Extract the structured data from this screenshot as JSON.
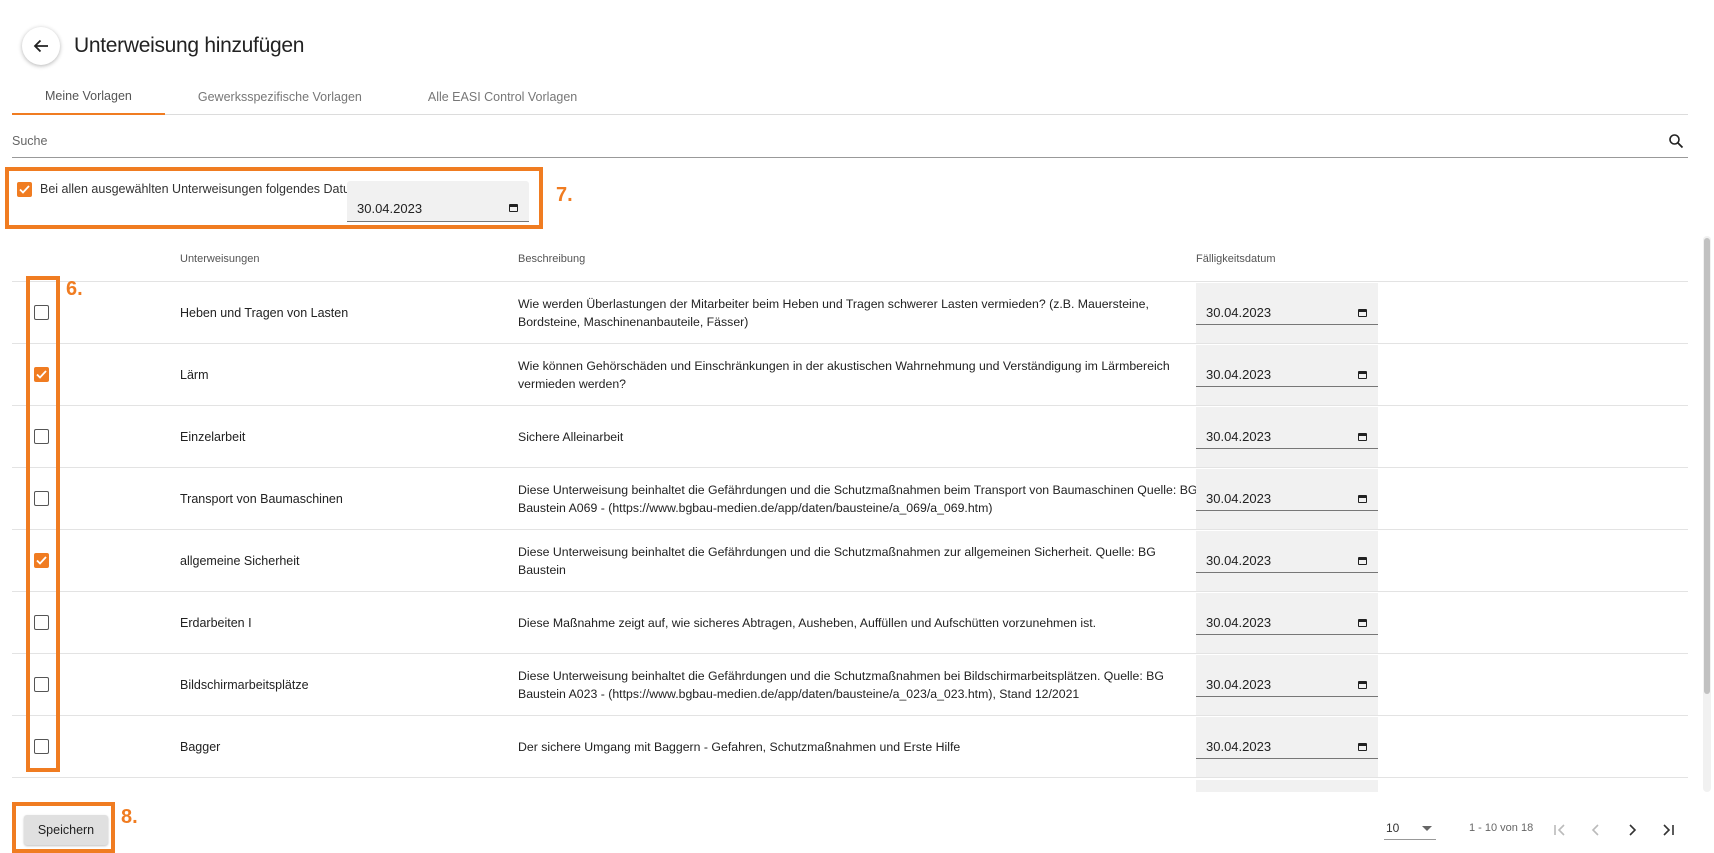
{
  "header": {
    "title": "Unterweisung hinzufügen"
  },
  "tabs": [
    {
      "label": "Meine Vorlagen",
      "active": true
    },
    {
      "label": "Gewerksspezifische Vorlagen",
      "active": false
    },
    {
      "label": "Alle EASI Control Vorlagen",
      "active": false
    }
  ],
  "search": {
    "placeholder": "Suche",
    "value": ""
  },
  "bulk": {
    "checked": true,
    "label": "Bei allen ausgewählten Unterweisungen folgendes Datum Setzen",
    "date": "30.04.2023"
  },
  "markers": {
    "bulk": "7.",
    "checkboxes": "6.",
    "save": "8."
  },
  "table": {
    "headers": {
      "name": "Unterweisungen",
      "description": "Beschreibung",
      "due": "Fälligkeitsdatum"
    },
    "rows": [
      {
        "checked": false,
        "name": "Heben und Tragen von Lasten",
        "description": "Wie werden Überlastungen der Mitarbeiter beim Heben und Tragen schwerer Lasten vermieden? (z.B. Mauersteine, Bordsteine, Maschinenanbauteile, Fässer)",
        "date": "30.04.2023"
      },
      {
        "checked": true,
        "name": "Lärm",
        "description": "Wie können Gehörschäden und Einschränkungen in der akustischen Wahrnehmung und Verständigung im Lärmbereich vermieden werden?",
        "date": "30.04.2023"
      },
      {
        "checked": false,
        "name": "Einzelarbeit",
        "description": "Sichere Alleinarbeit",
        "date": "30.04.2023"
      },
      {
        "checked": false,
        "name": "Transport von Baumaschinen",
        "description": "Diese Unterweisung beinhaltet die Gefährdungen und die Schutzmaßnahmen beim Transport von Baumaschinen Quelle: BG Baustein A069 - (https://www.bgbau-medien.de/app/daten/bausteine/a_069/a_069.htm)",
        "date": "30.04.2023"
      },
      {
        "checked": true,
        "name": "allgemeine Sicherheit",
        "description": "Diese Unterweisung beinhaltet die Gefährdungen und die Schutzmaßnahmen zur allgemeinen Sicherheit. Quelle: BG Baustein",
        "date": "30.04.2023"
      },
      {
        "checked": false,
        "name": "Erdarbeiten I",
        "description": "Diese Maßnahme zeigt auf, wie sicheres Abtragen, Ausheben, Auffüllen und Aufschütten vorzunehmen ist.",
        "date": "30.04.2023"
      },
      {
        "checked": false,
        "name": "Bildschirmarbeitsplätze",
        "description": "Diese Unterweisung beinhaltet die Gefährdungen und die Schutzmaßnahmen bei Bildschirmarbeitsplätzen. Quelle: BG Baustein A023 - (https://www.bgbau-medien.de/app/daten/bausteine/a_023/a_023.htm), Stand 12/2021",
        "date": "30.04.2023"
      },
      {
        "checked": false,
        "name": "Bagger",
        "description": "Der sichere Umgang mit Baggern - Gefahren, Schutzmaßnahmen und Erste Hilfe",
        "date": "30.04.2023"
      }
    ]
  },
  "footer": {
    "save_label": "Speichern",
    "page_size": "10",
    "range": "1 - 10 von 18"
  }
}
